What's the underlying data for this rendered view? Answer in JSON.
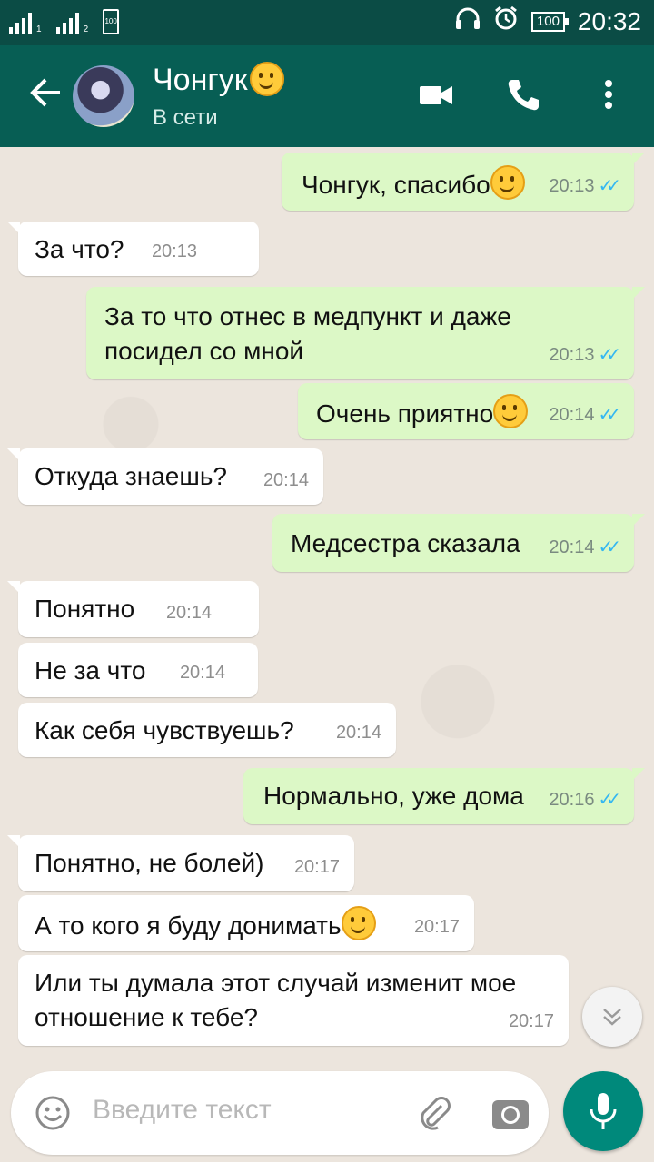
{
  "status_bar": {
    "sim1": "1",
    "sim2": "2",
    "battery_small": "100",
    "battery": "100",
    "time": "20:32"
  },
  "header": {
    "contact_name": "Чонгук",
    "contact_status": "В сети",
    "name_emoji": "smirk-emoji"
  },
  "messages": [
    {
      "dir": "out",
      "text": "Чонгук, спасибо",
      "emoji": true,
      "time": "20:13",
      "read": true
    },
    {
      "dir": "in",
      "text": "За что?",
      "time": "20:13"
    },
    {
      "dir": "out",
      "text": "За то что отнес в медпункт и даже\nпосидел со мной",
      "time": "20:13",
      "read": true
    },
    {
      "dir": "out",
      "text": "Очень приятно",
      "emoji": true,
      "time": "20:14",
      "read": true
    },
    {
      "dir": "in",
      "text": "Откуда знаешь?",
      "time": "20:14"
    },
    {
      "dir": "out",
      "text": "Медсестра сказала",
      "time": "20:14",
      "read": true
    },
    {
      "dir": "in",
      "text": "Понятно",
      "time": "20:14"
    },
    {
      "dir": "in",
      "text": "Не за что",
      "time": "20:14"
    },
    {
      "dir": "in",
      "text": "Как себя чувствуешь?",
      "time": "20:14"
    },
    {
      "dir": "out",
      "text": "Нормально, уже дома",
      "time": "20:16",
      "read": true
    },
    {
      "dir": "in",
      "text": "Понятно, не болей)",
      "time": "20:17"
    },
    {
      "dir": "in",
      "text": "А то кого я буду донимать",
      "emoji": true,
      "time": "20:17"
    },
    {
      "dir": "in",
      "text": "Или ты думала этот случай изменит мое\nотношение к тебе?",
      "time": "20:17"
    }
  ],
  "composer": {
    "placeholder": "Введите текст"
  },
  "colors": {
    "header": "#075e54",
    "status_bar": "#0b4c45",
    "outgoing": "#dcf8c6",
    "incoming": "#ffffff",
    "ticks": "#34b7f1",
    "mic": "#00897b"
  }
}
